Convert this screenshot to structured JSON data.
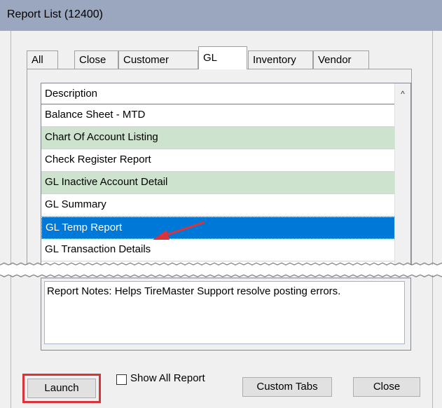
{
  "window": {
    "title": "Report List (12400)"
  },
  "tabs": [
    {
      "label": "All",
      "active": false
    },
    {
      "label": "Close",
      "active": false
    },
    {
      "label": "Customer",
      "active": false
    },
    {
      "label": "GL",
      "active": true
    },
    {
      "label": "Inventory",
      "active": false
    },
    {
      "label": "Vendor",
      "active": false
    }
  ],
  "list": {
    "header": "Description",
    "rows": [
      {
        "label": "Balance Sheet - MTD",
        "state": "white"
      },
      {
        "label": "Chart Of Account Listing",
        "state": "alt"
      },
      {
        "label": "Check Register Report",
        "state": "white"
      },
      {
        "label": "GL Inactive Account Detail",
        "state": "alt"
      },
      {
        "label": "GL Summary",
        "state": "white"
      },
      {
        "label": "GL Temp Report",
        "state": "selected"
      },
      {
        "label": "GL Transaction Details",
        "state": "white"
      }
    ]
  },
  "notes": {
    "text": "Report Notes:  Helps TireMaster Support resolve posting errors."
  },
  "footer": {
    "launch_label": "Launch",
    "show_all_label": "Show All Report",
    "custom_tabs_label": "Custom Tabs",
    "close_label": "Close"
  },
  "colors": {
    "selected": "#0078d7",
    "alt_row": "#cde3cd",
    "annotation": "#d9343a"
  }
}
